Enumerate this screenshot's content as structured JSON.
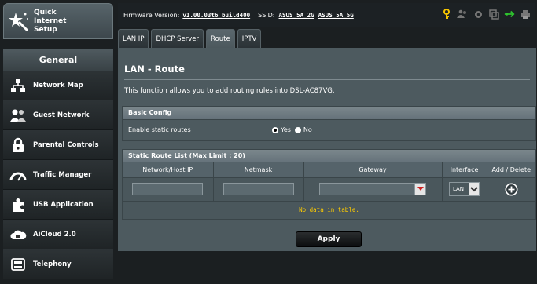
{
  "sidebar": {
    "quick_setup": {
      "label": "Quick Internet Setup",
      "icon": "wand-icon"
    },
    "general_header": "General",
    "items": [
      {
        "label": "Network Map",
        "icon": "network-map-icon"
      },
      {
        "label": "Guest Network",
        "icon": "guest-network-icon"
      },
      {
        "label": "Parental Controls",
        "icon": "lock-icon"
      },
      {
        "label": "Traffic Manager",
        "icon": "speedometer-icon"
      },
      {
        "label": "USB Application",
        "icon": "puzzle-icon"
      },
      {
        "label": "AiCloud 2.0",
        "icon": "cloud-icon"
      },
      {
        "label": "Telephony",
        "icon": "telephone-icon"
      }
    ]
  },
  "topbar": {
    "firmware_label": "Firmware Version:",
    "firmware_value": "v1.00.03t6_build400",
    "ssid_label": "SSID:",
    "ssid_2g": "ASUS_5A_2G",
    "ssid_5g": "ASUS_5A_5G"
  },
  "tabs": [
    {
      "label": "LAN IP",
      "active": false
    },
    {
      "label": "DHCP Server",
      "active": false
    },
    {
      "label": "Route",
      "active": true
    },
    {
      "label": "IPTV",
      "active": false
    }
  ],
  "page": {
    "title": "LAN - Route",
    "description": "This function allows you to add routing rules into DSL-AC87VG."
  },
  "basic_config": {
    "header": "Basic Config",
    "enable_label": "Enable static routes",
    "yes_label": "Yes",
    "no_label": "No",
    "selected": "Yes"
  },
  "route_list": {
    "header": "Static Route List (Max Limit : 20)",
    "columns": [
      "Network/Host IP",
      "Netmask",
      "Gateway",
      "Interface",
      "Add / Delete"
    ],
    "interface_value": "LAN",
    "empty_message": "No data in table."
  },
  "apply_label": "Apply",
  "colors": {
    "panel": "#4d5a5f",
    "header_bar": "#727e84",
    "no_data_text": "#ffcc00",
    "gateway_arrow": "#cc2222"
  }
}
